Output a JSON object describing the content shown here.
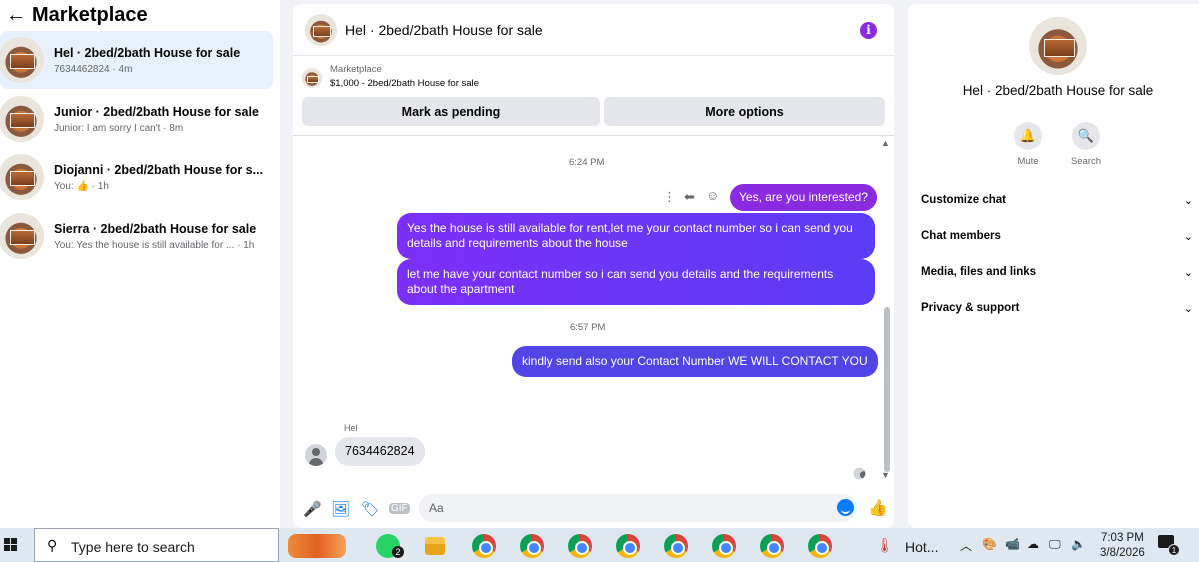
{
  "left": {
    "back_icon": "←",
    "title": "Marketplace",
    "conversations": [
      {
        "name": "Hel · 2bed/2bath House for sale",
        "sub": "7634462824 · 4m"
      },
      {
        "name": "Junior · 2bed/2bath House for sale",
        "sub": "Junior: I am sorry I can't · 8m"
      },
      {
        "name": "Diojanni · 2bed/2bath House for s...",
        "sub_prefix": "You:",
        "sub_icon": "thumbs-up-icon",
        "sub_suffix": "· 1h"
      },
      {
        "name": "Sierra · 2bed/2bath House for sale",
        "sub": "You: Yes the house is still available for ... · 1h"
      }
    ]
  },
  "chat": {
    "title": "Hel · 2bed/2bath House for sale",
    "listing_source": "Marketplace",
    "listing_detail": "$1,000 - 2bed/2bath House for sale",
    "mark_pending": "Mark as pending",
    "more_options": "More options",
    "time1": "6:24 PM",
    "msg_yes": "Yes, are you interested?",
    "msg_available": "Yes the house is still available for rent,let me your contact number so i can send you details and requirements about the house",
    "msg_contact": "let me have your contact number so i can send you details and the requirements about the apartment",
    "time2": "6:57 PM",
    "msg_kindly": "kindly send also your Contact Number  WE WILL CONTACT YOU",
    "incoming_sender": "Hel",
    "incoming_msg": "7634462824",
    "compose_placeholder": "Aa"
  },
  "details": {
    "title": "Hel · 2bed/2bath House for sale",
    "mute": "Mute",
    "search": "Search",
    "sections": [
      "Customize chat",
      "Chat members",
      "Media, files and links",
      "Privacy & support"
    ]
  },
  "taskbar": {
    "search_placeholder": "Type here to search",
    "whatsapp_badge": "2",
    "weather": "Hot...",
    "time": "7:03 PM",
    "date": "3/8/2026",
    "notification_count": "1"
  },
  "colors": {
    "accent": "#8a2be2",
    "messenger_blue": "#0a7cff",
    "active_row": "#e7f0fb"
  }
}
